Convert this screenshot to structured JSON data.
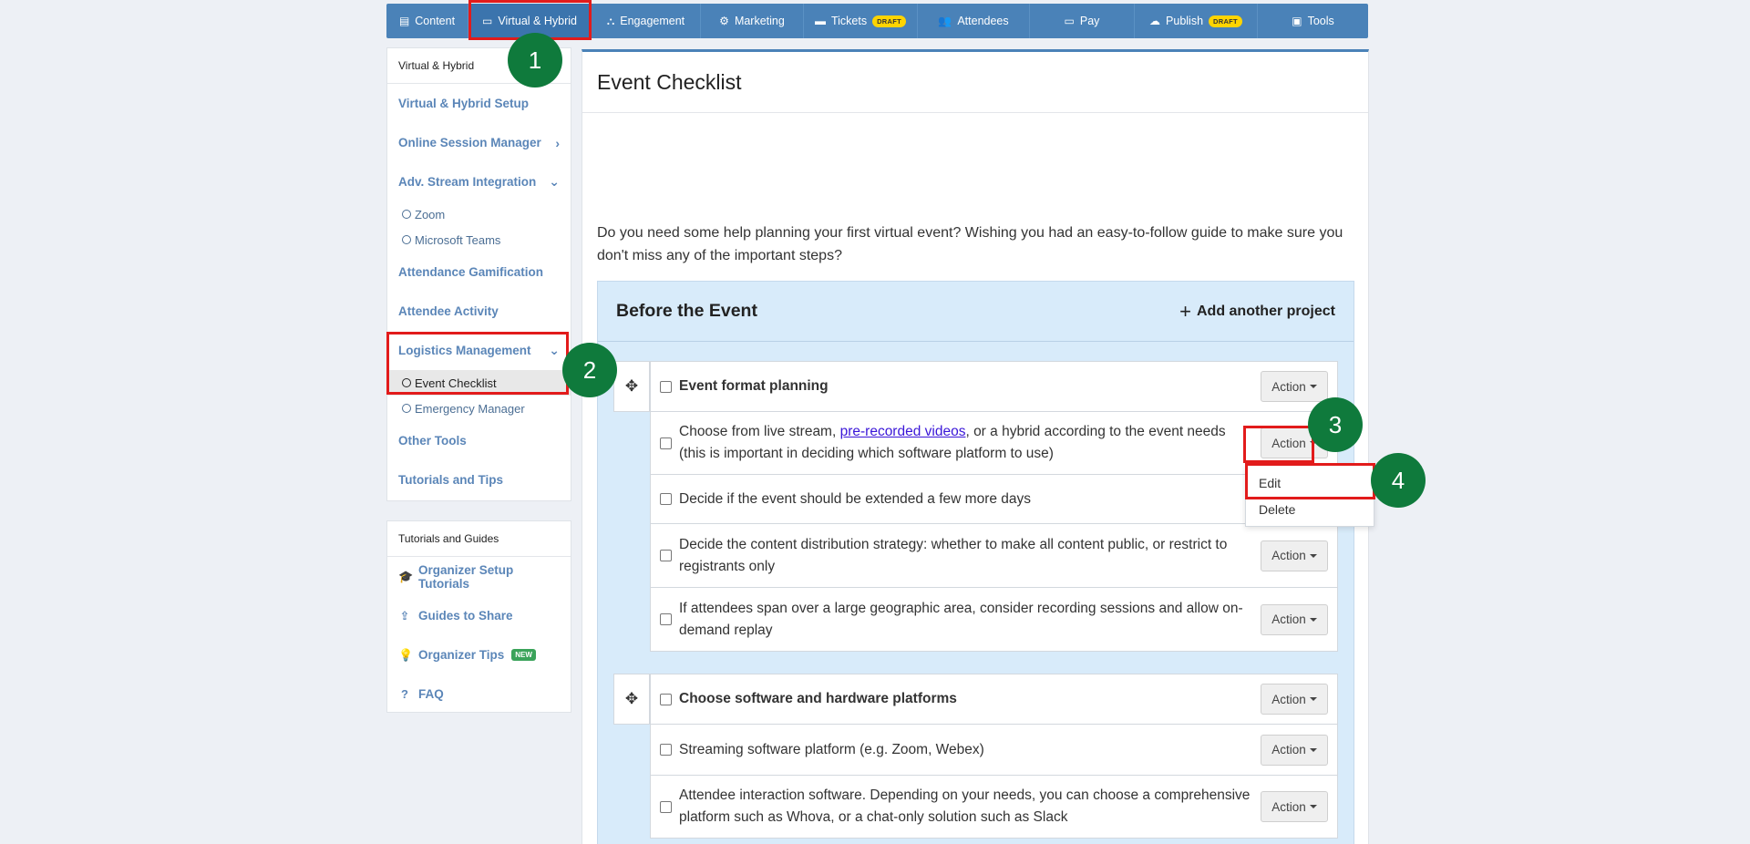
{
  "topnav": {
    "items": [
      {
        "label": "Content",
        "icon": "content-icon",
        "glyph": "▤"
      },
      {
        "label": "Virtual & Hybrid",
        "icon": "laptop-icon",
        "glyph": "▭"
      },
      {
        "label": "Engagement",
        "icon": "network-icon",
        "glyph": "⛬"
      },
      {
        "label": "Marketing",
        "icon": "marketing-icon",
        "glyph": "⚙"
      },
      {
        "label": "Tickets",
        "icon": "ticket-icon",
        "glyph": "▬",
        "badge": "DRAFT"
      },
      {
        "label": "Attendees",
        "icon": "users-icon",
        "glyph": "👥"
      },
      {
        "label": "Pay",
        "icon": "card-icon",
        "glyph": "▭"
      },
      {
        "label": "Publish",
        "icon": "cloud-upload-icon",
        "glyph": "☁",
        "badge": "DRAFT"
      },
      {
        "label": "Tools",
        "icon": "toolbox-icon",
        "glyph": "▣"
      }
    ],
    "active": "Virtual & Hybrid",
    "badge_color": "#ffd400"
  },
  "sidebar": {
    "heading": "Virtual & Hybrid",
    "items": {
      "setup": "Virtual & Hybrid Setup",
      "online_session": "Online Session Manager",
      "adv_stream": "Adv. Stream Integration",
      "zoom": "Zoom",
      "teams": "Microsoft Teams",
      "gamification": "Attendance Gamification",
      "activity": "Attendee Activity",
      "logistics": "Logistics Management",
      "checklist": "Event Checklist",
      "emergency": "Emergency Manager",
      "other": "Other Tools",
      "tutorials": "Tutorials and Tips"
    }
  },
  "guides": {
    "heading": "Tutorials and Guides",
    "items": {
      "setup_tutorials": "Organizer Setup Tutorials",
      "share": "Guides to Share",
      "tips": "Organizer Tips",
      "tips_badge": "NEW",
      "faq": "FAQ"
    }
  },
  "main": {
    "title": "Event Checklist",
    "intro": "Do you need some help planning your first virtual event? Wishing you had an easy-to-follow guide to make sure you don't miss any of the important steps?",
    "project": {
      "title": "Before the Event",
      "add_label": "Add another project",
      "action_label": "Action",
      "tasks": {
        "t1": "Event format planning",
        "t1a_pre": "Choose from live stream, ",
        "t1a_link": "pre-recorded videos",
        "t1a_post": ", or a hybrid according to the event needs (this is important in deciding which software platform to use)",
        "t1b": "Decide if the event should be extended a few more days",
        "t1c": "Decide the content distribution strategy: whether to make all content public, or restrict to registrants only",
        "t1d": "If attendees span over a large geographic area, consider recording sessions and allow on-demand replay",
        "t2": "Choose software and hardware platforms",
        "t2a": "Streaming software platform (e.g. Zoom, Webex)",
        "t2b": "Attendee interaction software. Depending on your needs, you can choose a comprehensive platform such as Whova, or a chat-only solution such as Slack"
      }
    }
  },
  "dropdown": {
    "edit": "Edit",
    "delete": "Delete"
  },
  "annotations": {
    "b1": "1",
    "b2": "2",
    "b3": "3",
    "b4": "4",
    "highlight_color": "#e21b1b",
    "badge_color": "#0f7a3c"
  }
}
